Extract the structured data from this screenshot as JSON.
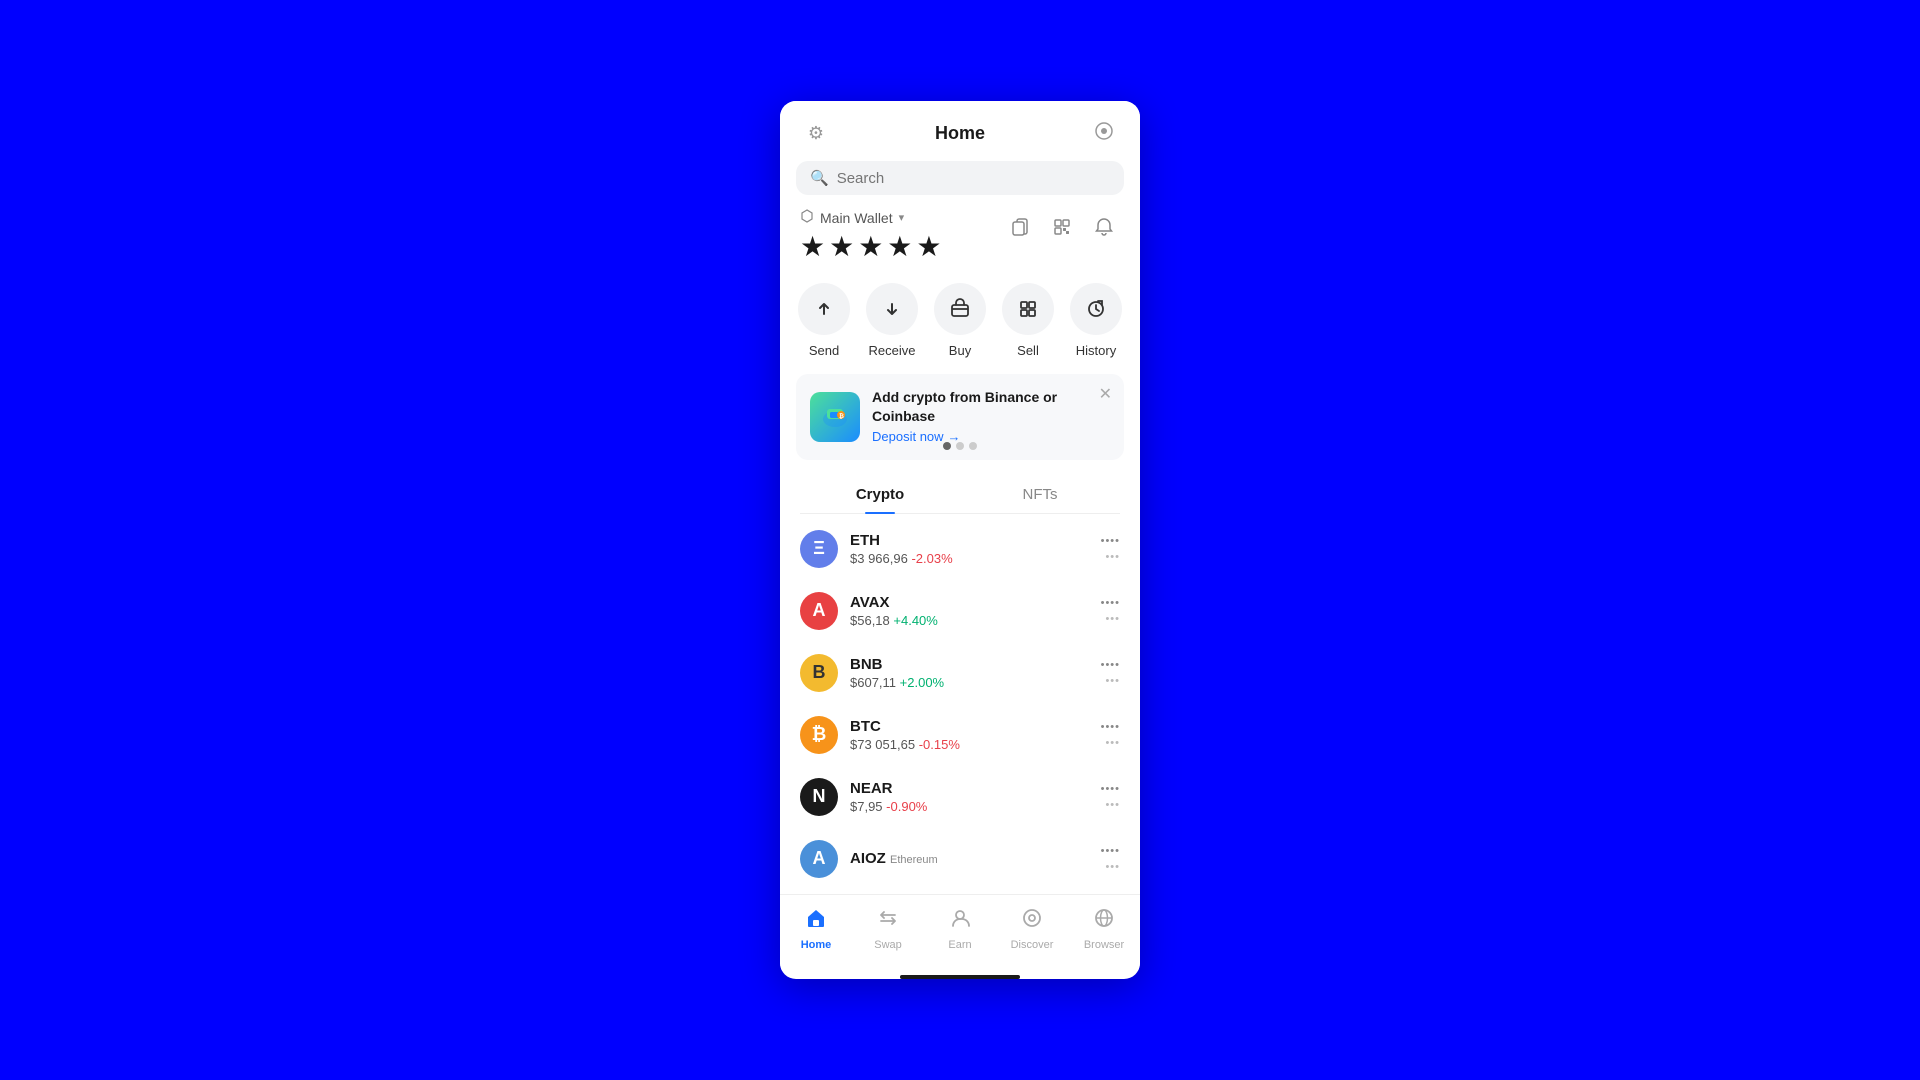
{
  "header": {
    "title": "Home",
    "settings_icon": "⚙",
    "link_icon": "🔗"
  },
  "search": {
    "placeholder": "Search"
  },
  "wallet": {
    "name": "Main Wallet",
    "balance_masked": "★★★★★",
    "copy_icon": "⧉",
    "qr_icon": "⊞",
    "bell_icon": "🔔"
  },
  "actions": [
    {
      "id": "send",
      "label": "Send",
      "icon": "↑"
    },
    {
      "id": "receive",
      "label": "Receive",
      "icon": "↓"
    },
    {
      "id": "buy",
      "label": "Buy",
      "icon": "≡"
    },
    {
      "id": "sell",
      "label": "Sell",
      "icon": "🏦"
    },
    {
      "id": "history",
      "label": "History",
      "icon": "🕐"
    }
  ],
  "promo": {
    "title": "Add crypto from Binance or Coinbase",
    "cta": "Deposit now",
    "cta_arrow": "→",
    "dots": [
      true,
      false,
      false
    ]
  },
  "tabs": [
    {
      "id": "crypto",
      "label": "Crypto",
      "active": true
    },
    {
      "id": "nfts",
      "label": "NFTs",
      "active": false
    }
  ],
  "coins": [
    {
      "symbol": "ETH",
      "price": "$3 966,96",
      "change": "-2.03%",
      "change_type": "negative",
      "icon_text": "Ξ",
      "icon_class": "eth-icon",
      "stars": "••••",
      "menu": "•••"
    },
    {
      "symbol": "AVAX",
      "price": "$56,18",
      "change": "+4.40%",
      "change_type": "positive",
      "icon_text": "A",
      "icon_class": "avax-icon",
      "stars": "••••",
      "menu": "•••"
    },
    {
      "symbol": "BNB",
      "price": "$607,11",
      "change": "+2.00%",
      "change_type": "positive",
      "icon_text": "B",
      "icon_class": "bnb-icon",
      "stars": "••••",
      "menu": "•••"
    },
    {
      "symbol": "BTC",
      "price": "$73 051,65",
      "change": "-0.15%",
      "change_type": "negative",
      "icon_text": "₿",
      "icon_class": "btc-icon",
      "stars": "••••",
      "menu": "•••"
    },
    {
      "symbol": "NEAR",
      "price": "$7,95",
      "change": "-0.90%",
      "change_type": "negative",
      "icon_text": "N",
      "icon_class": "near-icon",
      "stars": "••••",
      "menu": "•••"
    },
    {
      "symbol": "AIOZ",
      "subtitle": "Ethereum",
      "price": "",
      "change": "",
      "change_type": "",
      "icon_text": "A",
      "icon_class": "aioz-icon",
      "stars": "••••",
      "menu": "•••"
    }
  ],
  "bottom_nav": [
    {
      "id": "home",
      "label": "Home",
      "icon": "⌂",
      "active": true
    },
    {
      "id": "swap",
      "label": "Swap",
      "icon": "⇄",
      "active": false
    },
    {
      "id": "earn",
      "label": "Earn",
      "icon": "👤",
      "active": false
    },
    {
      "id": "discover",
      "label": "Discover",
      "icon": "◎",
      "active": false
    },
    {
      "id": "browser",
      "label": "Browser",
      "icon": "🌐",
      "active": false
    }
  ]
}
